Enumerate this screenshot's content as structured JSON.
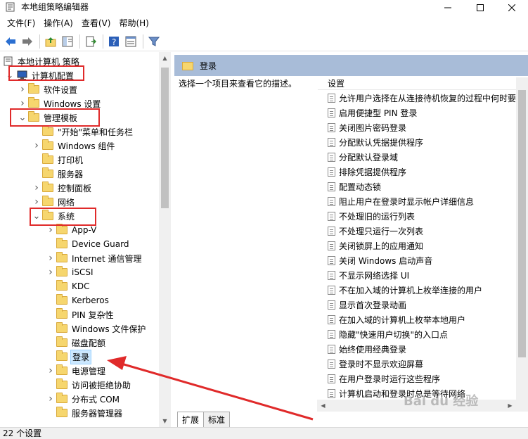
{
  "window": {
    "title": "本地组策略编辑器"
  },
  "menu": [
    "文件(F)",
    "操作(A)",
    "查看(V)",
    "帮助(H)"
  ],
  "tree": {
    "root": "本地计算机 策略",
    "items": [
      {
        "label": "计算机配置",
        "indent": 1,
        "expand": "v"
      },
      {
        "label": "软件设置",
        "indent": 2,
        "expand": ">"
      },
      {
        "label": "Windows 设置",
        "indent": 2,
        "expand": ">"
      },
      {
        "label": "管理模板",
        "indent": 2,
        "expand": "v"
      },
      {
        "label": "\"开始\"菜单和任务栏",
        "indent": 3,
        "expand": ""
      },
      {
        "label": "Windows 组件",
        "indent": 3,
        "expand": ">"
      },
      {
        "label": "打印机",
        "indent": 3,
        "expand": ""
      },
      {
        "label": "服务器",
        "indent": 3,
        "expand": ""
      },
      {
        "label": "控制面板",
        "indent": 3,
        "expand": ">"
      },
      {
        "label": "网络",
        "indent": 3,
        "expand": ">"
      },
      {
        "label": "系统",
        "indent": 3,
        "expand": "v"
      },
      {
        "label": "App-V",
        "indent": 4,
        "expand": ">"
      },
      {
        "label": "Device Guard",
        "indent": 4,
        "expand": ""
      },
      {
        "label": "Internet 通信管理",
        "indent": 4,
        "expand": ">"
      },
      {
        "label": "iSCSI",
        "indent": 4,
        "expand": ">"
      },
      {
        "label": "KDC",
        "indent": 4,
        "expand": ""
      },
      {
        "label": "Kerberos",
        "indent": 4,
        "expand": ""
      },
      {
        "label": "PIN 复杂性",
        "indent": 4,
        "expand": ""
      },
      {
        "label": "Windows 文件保护",
        "indent": 4,
        "expand": ""
      },
      {
        "label": "磁盘配额",
        "indent": 4,
        "expand": ""
      },
      {
        "label": "登录",
        "indent": 4,
        "expand": "",
        "selected": true
      },
      {
        "label": "电源管理",
        "indent": 4,
        "expand": ">"
      },
      {
        "label": "访问被拒绝协助",
        "indent": 4,
        "expand": ""
      },
      {
        "label": "分布式 COM",
        "indent": 4,
        "expand": ">"
      },
      {
        "label": "服务器管理器",
        "indent": 4,
        "expand": ""
      }
    ]
  },
  "details": {
    "header": "登录",
    "description": "选择一个项目来查看它的描述。",
    "column": "设置",
    "settings": [
      "允许用户选择在从连接待机恢复的过程中何时要",
      "启用便捷型 PIN 登录",
      "关闭图片密码登录",
      "分配默认凭据提供程序",
      "分配默认登录域",
      "排除凭据提供程序",
      "配置动态锁",
      "阻止用户在登录时显示帐户详细信息",
      "不处理旧的运行列表",
      "不处理只运行一次列表",
      "关闭锁屏上的应用通知",
      "关闭 Windows 启动声音",
      "不显示网络选择 UI",
      "不在加入域的计算机上枚举连接的用户",
      "显示首次登录动画",
      "在加入域的计算机上枚举本地用户",
      "隐藏\"快速用户切换\"的入口点",
      "始终使用经典登录",
      "登录时不显示欢迎屏幕",
      "在用户登录时运行这些程序",
      "计算机启动和登录时总是等待网络"
    ],
    "tabs": [
      "扩展",
      "标准"
    ]
  },
  "status": "22 个设置",
  "watermark": "Bai du 经验",
  "colors": {
    "annotation": "#e02a2a",
    "header_bg": "#a8bcd8",
    "selected": "#cce8ff"
  }
}
